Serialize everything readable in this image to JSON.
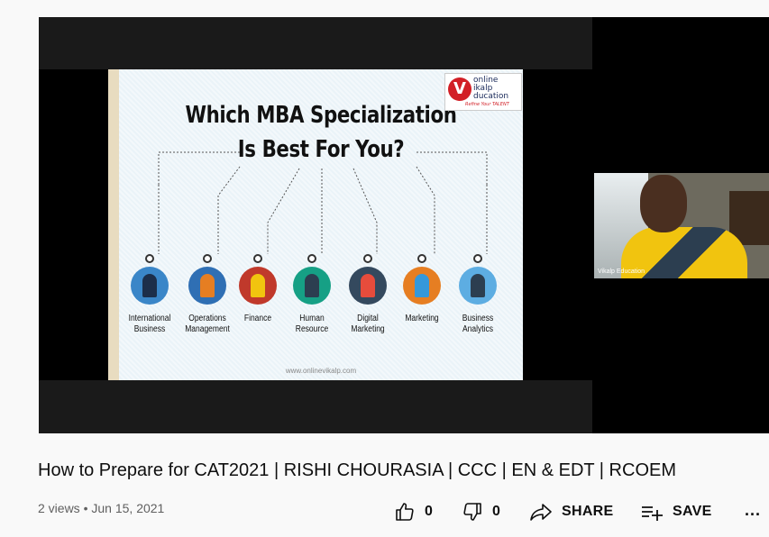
{
  "video": {
    "slide": {
      "title_line1": "Which MBA Specialization",
      "title_line2": "Is Best For You?",
      "logo": {
        "mark": "V",
        "line1": "online",
        "line2": "ikalp",
        "line3": "ducation",
        "tagline": "Refine Your TALENT"
      },
      "specializations": [
        {
          "label": "International Business",
          "color": "#3a86c8"
        },
        {
          "label": "Operations Management",
          "color": "#2f6fb4"
        },
        {
          "label": "Finance",
          "color": "#c0392b"
        },
        {
          "label": "Human Resource",
          "color": "#16a085"
        },
        {
          "label": "Digital Marketing",
          "color": "#34495e"
        },
        {
          "label": "Marketing",
          "color": "#e67e22"
        },
        {
          "label": "Business Analytics",
          "color": "#5dade2"
        }
      ],
      "url": "www.onlinevikalp.com"
    },
    "camera_name": "Vikalp Education"
  },
  "info": {
    "title": "How to Prepare for CAT2021 | RISHI CHOURASIA | CCC | EN & EDT | RCOEM",
    "views": "2 views",
    "date": "Jun 15, 2021",
    "likes": "0",
    "dislikes": "0",
    "share_label": "SHARE",
    "save_label": "SAVE",
    "more_label": "..."
  },
  "icons": [
    "thumbs-up-icon",
    "thumbs-down-icon",
    "share-icon",
    "save-playlist-icon",
    "more-icon"
  ]
}
